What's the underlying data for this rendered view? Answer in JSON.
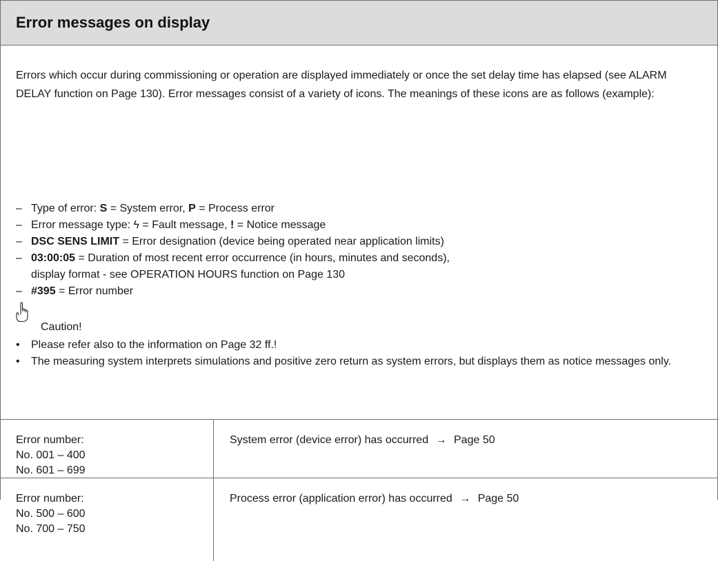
{
  "header": {
    "title": "Error messages on display"
  },
  "intro": "Errors which occur during commissioning or operation are displayed immediately or once the set delay time has elapsed (see ALARM DELAY function on Page 130). Error messages consist of a variety of icons. The meanings of these icons are as follows (example):",
  "legend": {
    "dash": "–",
    "type_prefix": "Type of error: ",
    "s_key": "S",
    "s_text": " = System error, ",
    "p_key": "P",
    "p_text": " = Process error",
    "msg_prefix": "Error message type: ",
    "fault_key": "ϟ",
    "fault_text": " = Fault message, ",
    "notice_key": "!",
    "notice_text": " = Notice message",
    "designation_key": "DSC SENS LIMIT",
    "designation_text": " = Error designation (device being operated near application limits)",
    "duration_key": "03:00:05",
    "duration_text": " = Duration of most recent error occurrence (in hours, minutes and seconds),",
    "duration_cont": "display format - see OPERATION HOURS function on Page 130",
    "number_key": "#395",
    "number_text": " = Error number"
  },
  "caution": {
    "icon": "pointing-hand-icon",
    "label": "Caution!",
    "bullet": "•",
    "items": [
      "Please refer also to the information on Page 32 ff.!",
      "The measuring system interprets simulations and positive zero return as system errors, but displays them as notice messages only."
    ]
  },
  "table": {
    "rows": [
      {
        "label": "Error number:",
        "ranges": [
          "No. 001 – 400",
          "No. 601  – 699"
        ],
        "description": "System error (device error) has occurred",
        "arrow": "→",
        "page": "Page 50"
      },
      {
        "label": "Error number:",
        "ranges": [
          "No. 500 – 600",
          "No. 700 – 750"
        ],
        "description": "Process error (application error) has occurred",
        "arrow": "→",
        "page": "Page 50"
      }
    ]
  }
}
